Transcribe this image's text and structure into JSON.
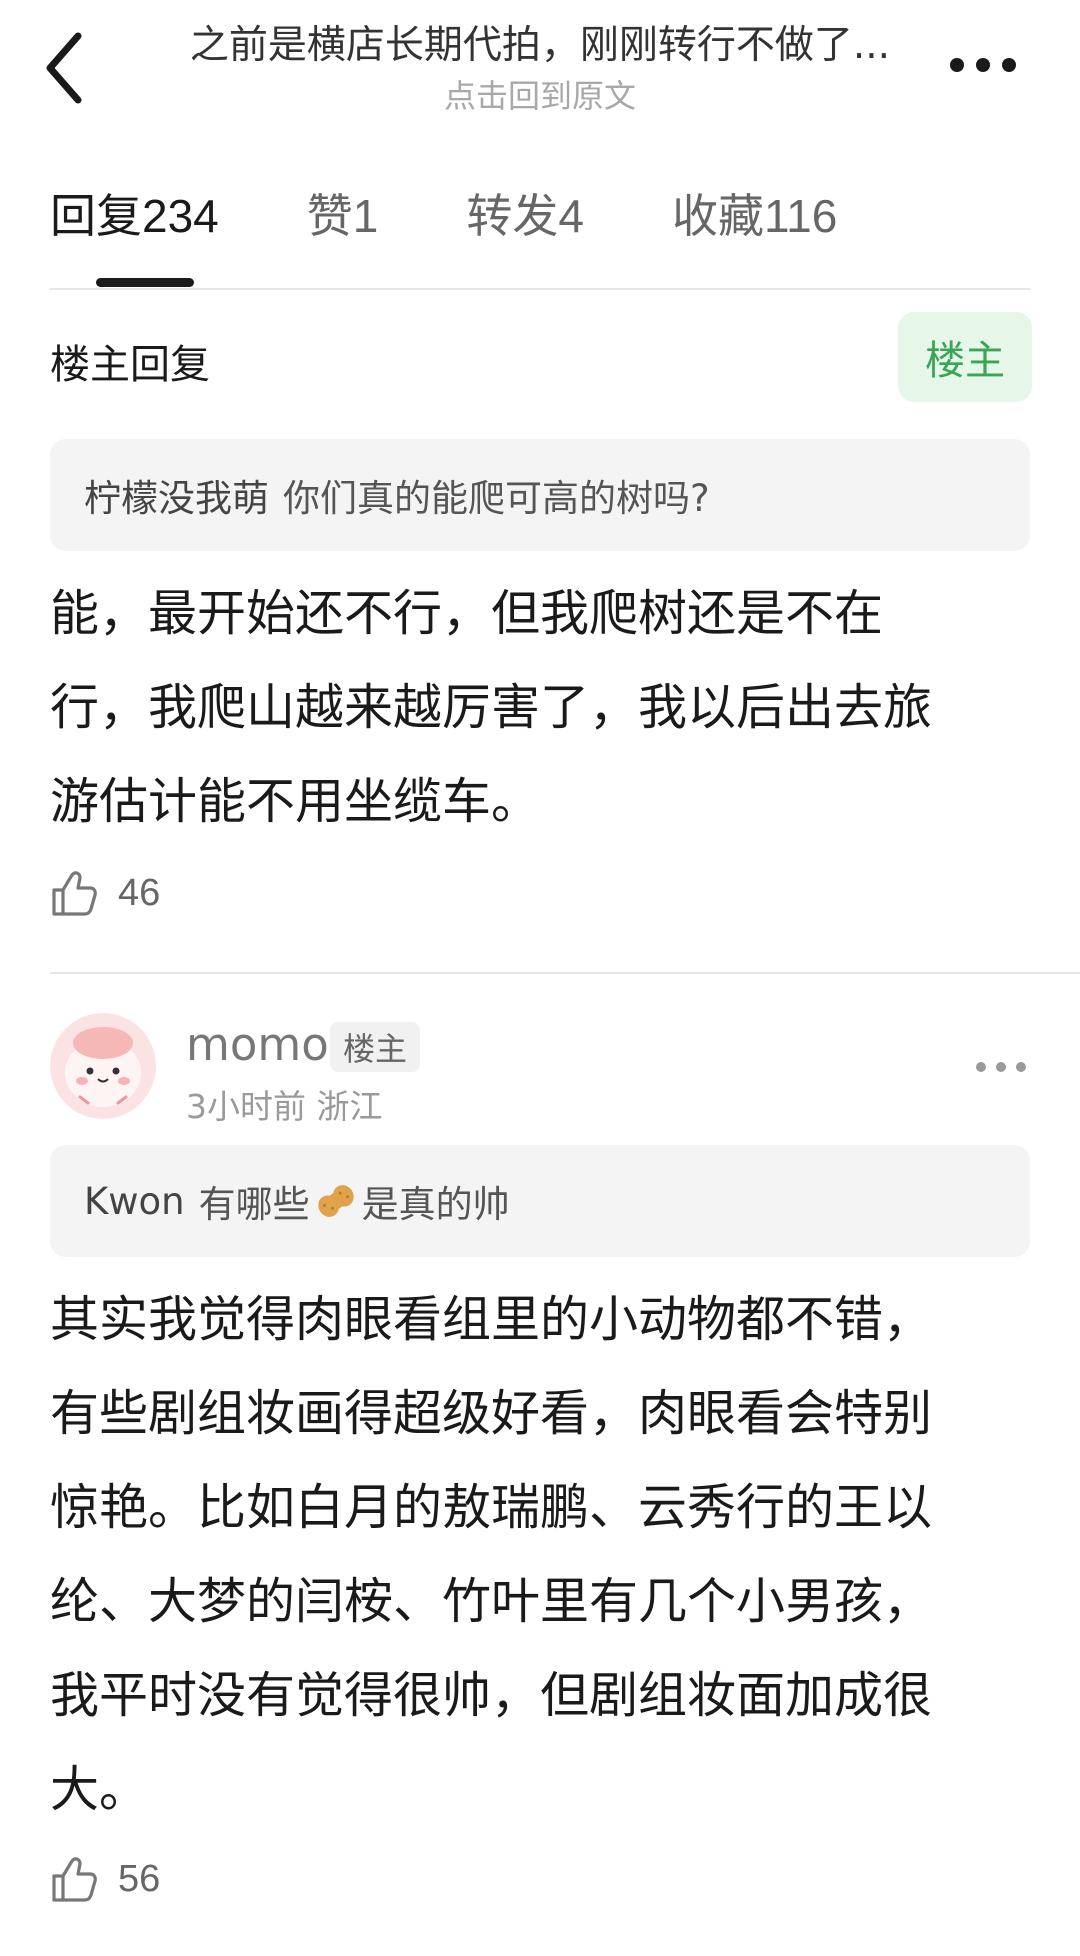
{
  "header": {
    "title": "之前是横店长期代拍，刚刚转行不做了...",
    "subtitle": "点击回到原文",
    "back_icon": "chevron-left-icon",
    "more_icon": "more-horizontal-icon"
  },
  "tabs": [
    {
      "label": "回复",
      "count": "234",
      "active": true
    },
    {
      "label": "赞",
      "count": "1"
    },
    {
      "label": "转发",
      "count": "4"
    },
    {
      "label": "收藏",
      "count": "116"
    }
  ],
  "section": {
    "title": "楼主回复",
    "owner_chip": "楼主"
  },
  "reply1": {
    "quote_name": "柠檬没我萌",
    "quote_text": "你们真的能爬可高的树吗?",
    "lines": [
      "能，最开始还不行，但我爬树还是不在",
      "行，我爬山越来越厉害了，我以后出去旅",
      "游估计能不用坐缆车。"
    ],
    "likes": "46"
  },
  "comment2": {
    "username": "momo",
    "badge": "楼主",
    "time": "3小时前",
    "location": "浙江",
    "quote_name": "Kwon",
    "quote_text_before": "有哪些",
    "quote_text_after": "是真的帅",
    "lines": [
      "其实我觉得肉眼看组里的小动物都不错，",
      "有些剧组妆画得超级好看，肉眼看会特别",
      "惊艳。比如白月的敖瑞鹏、云秀行的王以",
      "纶、大梦的闫桉、竹叶里有几个小男孩，",
      "我平时没有觉得很帅，但剧组妆面加成很",
      "大。"
    ],
    "likes": "56"
  },
  "colors": {
    "accent_green": "#3aa556",
    "chip_bg": "#e6f7ea",
    "quote_bg": "#f4f4f4"
  }
}
